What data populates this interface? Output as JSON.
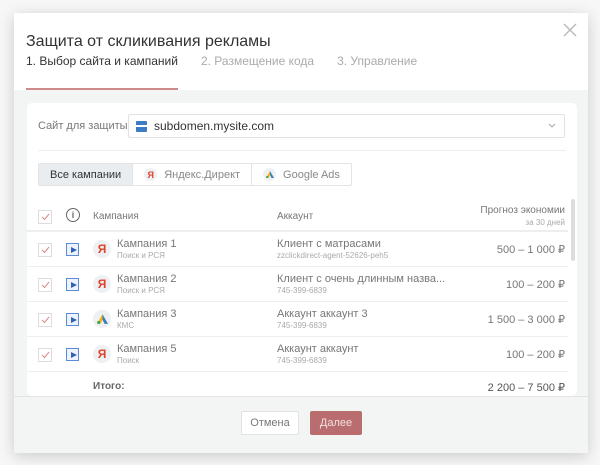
{
  "dialog": {
    "title": "Защита от скликивания рекламы"
  },
  "steps": [
    {
      "label": "1. Выбор сайта и кампаний",
      "active": true
    },
    {
      "label": "2. Размещение кода",
      "active": false
    },
    {
      "label": "3. Управление",
      "active": false
    }
  ],
  "site": {
    "label": "Сайт для защиты",
    "value": "subdomen.mysite.com"
  },
  "filters": [
    {
      "label": "Все кампании",
      "selected": true
    },
    {
      "label": "Яндекс.Директ",
      "icon": "yandex-icon"
    },
    {
      "label": "Google Ads",
      "icon": "google-ads-icon"
    }
  ],
  "table": {
    "headers": {
      "campaign": "Кампания",
      "account": "Аккаунт",
      "forecast": "Прогноз экономии",
      "forecast_sub": "за 30 дней"
    },
    "rows": [
      {
        "name": "Кампания 1",
        "type": "Поиск и РСЯ",
        "platform": "yandex",
        "account": "Клиент с матрасами",
        "account_id": "zzclickdirect-agent-52626-peh5",
        "forecast": "500 – 1 000 ₽",
        "checked": true
      },
      {
        "name": "Кампания 2",
        "type": "Поиск и РСЯ",
        "platform": "yandex",
        "account": "Клиент с очень длинным назва...",
        "account_id": "745-399-6839",
        "forecast": "100 – 200 ₽",
        "checked": true
      },
      {
        "name": "Кампания 3",
        "type": "КМС",
        "platform": "google",
        "account": "Аккаунт аккаунт  3",
        "account_id": "745-399-6839",
        "forecast": "1 500 – 3 000 ₽",
        "checked": true
      },
      {
        "name": "Кампания 5",
        "type": "Поиск",
        "platform": "yandex",
        "account": "Аккаунт аккаунт",
        "account_id": "745-399-6839",
        "forecast": "100 – 200 ₽",
        "checked": true
      }
    ],
    "total_label": "Итого:",
    "total_value": "2 200 – 7 500 ₽"
  },
  "footer": {
    "cancel": "Отмена",
    "next": "Далее"
  },
  "colors": {
    "accent": "#b96d6f",
    "tab_underline": "#cc8a8a",
    "yandex": "#e0432c",
    "link_blue": "#2e62b8"
  }
}
